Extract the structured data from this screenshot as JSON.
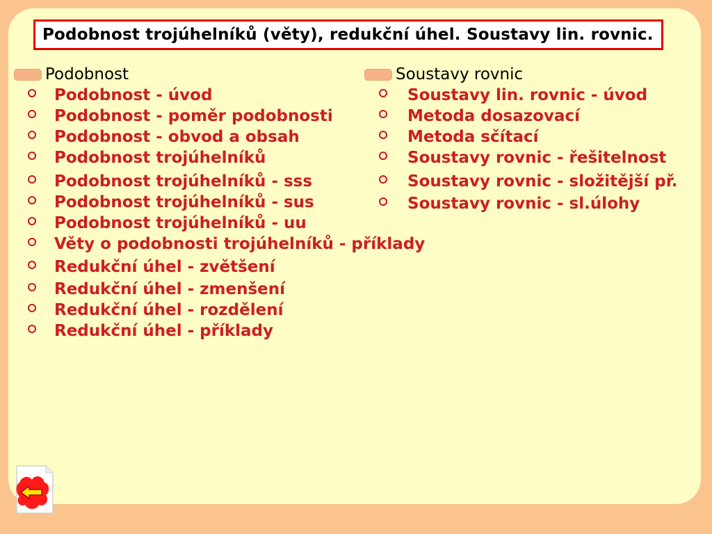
{
  "title": "Podobnost trojúhelníků (věty), redukční úhel. Soustavy lin. rovnic.",
  "left_section": {
    "heading": "Podobnost",
    "items": [
      "Podobnost - úvod",
      "Podobnost - poměr podobnosti",
      "Podobnost - obvod a obsah",
      "Podobnost trojúhelníků",
      "Podobnost trojúhelníků - sss",
      "Podobnost trojúhelníků - sus",
      "Podobnost trojúhelníků - uu",
      "Věty o podobnosti trojúhelníků - příklady",
      "Redukční úhel - zvětšení",
      "Redukční úhel - zmenšení",
      "Redukční úhel - rozdělení",
      "Redukční úhel - příklady"
    ]
  },
  "right_section": {
    "heading": "Soustavy rovnic",
    "items": [
      "Soustavy lin. rovnic - úvod",
      "Metoda dosazovací",
      "Metoda sčítací",
      "Soustavy rovnic - řešitelnost",
      "Soustavy rovnic - složitější př.",
      "Soustavy rovnic - sl.úlohy"
    ]
  },
  "back_button": {
    "icon": "back-arrow-icon"
  },
  "colors": {
    "background": "#fbc38e",
    "panel": "#fefdc5",
    "title_border": "#e30000",
    "link_text": "#cc1f1f"
  }
}
